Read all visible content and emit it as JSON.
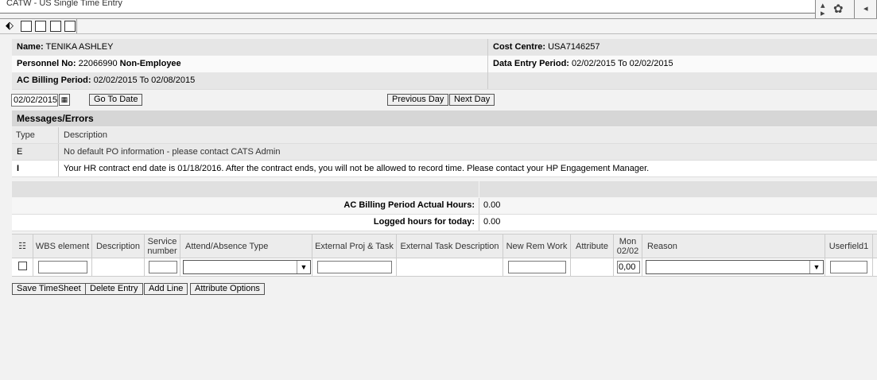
{
  "window": {
    "title": "CATW - US Single Time Entry"
  },
  "toolbar": {
    "icons": [
      "cursor-tool-icon",
      "save-icon",
      "copy-icon",
      "print-icon",
      "document-icon"
    ]
  },
  "header": {
    "name_label": "Name:",
    "name_value": "TENIKA ASHLEY",
    "cost_centre_label": "Cost Centre:",
    "cost_centre_value": "USA7146257",
    "personnel_label": "Personnel No:",
    "personnel_value": "22066990",
    "personnel_type": "Non-Employee",
    "data_entry_label": "Data Entry Period:",
    "data_entry_value": "02/02/2015 To 02/02/2015",
    "billing_label": "AC Billing Period:",
    "billing_value": "02/02/2015 To 02/08/2015"
  },
  "date_controls": {
    "date_value": "02/02/2015",
    "go_to_date": "Go To Date",
    "previous_day": "Previous Day",
    "next_day": "Next Day"
  },
  "messages": {
    "title": "Messages/Errors",
    "col_type": "Type",
    "col_description": "Description",
    "rows": [
      {
        "type": "E",
        "description": "No default PO information - please contact CATS Admin"
      },
      {
        "type": "I",
        "description": "Your HR contract end date is 01/18/2016. After the contract ends, you will not be allowed to record time. Please contact your HP Engagement Manager."
      }
    ]
  },
  "hours": {
    "billing_actual_label": "AC Billing Period Actual Hours:",
    "billing_actual_value": "0.00",
    "logged_today_label": "Logged hours for today:",
    "logged_today_value": "0.00"
  },
  "grid": {
    "columns": {
      "wbs": "WBS element",
      "description": "Description",
      "service": "Service number",
      "attend": "Attend/Absence Type",
      "ext_proj": "External Proj & Task",
      "ext_task": "External Task Description",
      "new_rem": "New Rem Work",
      "attribute": "Attribute",
      "mon": "Mon 02/02",
      "reason": "Reason",
      "userfield": "Userfield1"
    },
    "row": {
      "mon_value": "0,00"
    }
  },
  "actions": {
    "save": "Save TimeSheet",
    "delete": "Delete Entry",
    "add": "Add Line",
    "attribute_options": "Attribute Options"
  }
}
